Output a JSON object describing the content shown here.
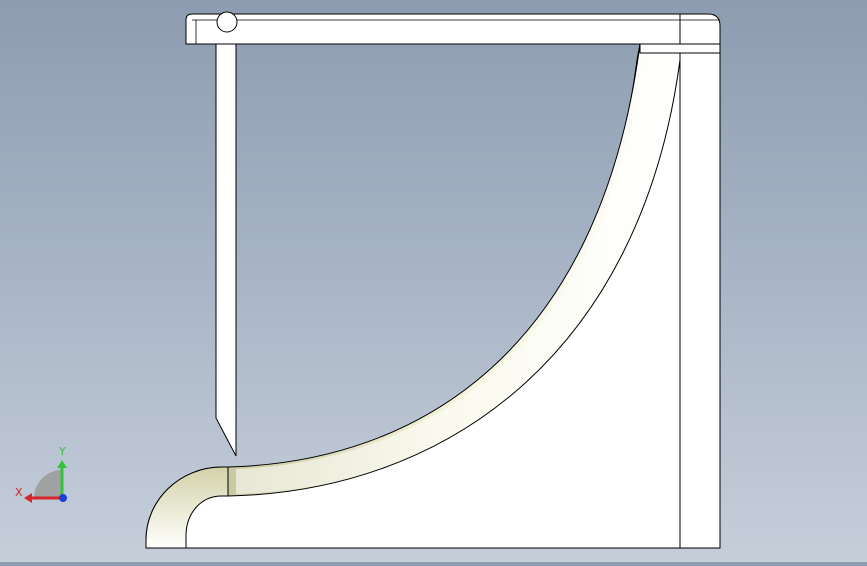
{
  "viewport": {
    "background_top": "#8d9cb0",
    "background_bottom": "#c6ceda"
  },
  "part": {
    "face_color": "#ffffff",
    "edge_color": "#000000",
    "fillet_shade_color": "#dcdcb4"
  },
  "triad": {
    "x_label": "X",
    "y_label": "Y",
    "x_color": "#d4262b",
    "y_color": "#35c23a",
    "z_color": "#1a3fd6",
    "origin_color": "#1a3fd6"
  }
}
